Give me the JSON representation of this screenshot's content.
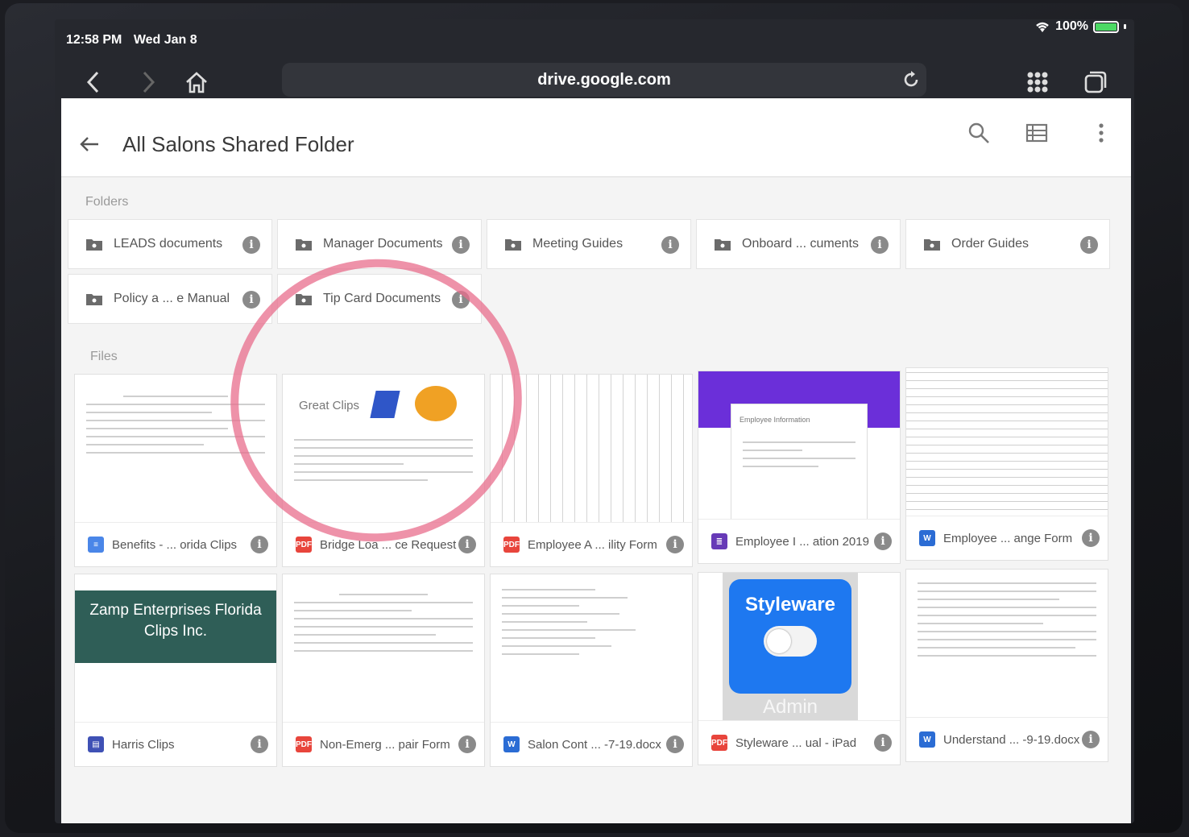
{
  "status_bar": {
    "time": "12:58 PM",
    "date": "Wed Jan 8",
    "battery": "100%"
  },
  "browser": {
    "url": "drive.google.com",
    "icons": [
      "back-icon",
      "forward-icon",
      "home-icon",
      "reload-icon",
      "grid-icon",
      "tabs-icon"
    ]
  },
  "appbar": {
    "title": "All Salons Shared Folder"
  },
  "sections": {
    "folders": "Folders",
    "files": "Files"
  },
  "folders": [
    {
      "label": "LEADS documents"
    },
    {
      "label": "Manager Documents"
    },
    {
      "label": "Meeting Guides"
    },
    {
      "label": "Onboard ... cuments"
    },
    {
      "label": "Order Guides"
    },
    {
      "label": "Policy a ... e Manual"
    },
    {
      "label": "Tip Card Documents"
    }
  ],
  "files": [
    {
      "label": "Benefits - ... orida Clips",
      "type": "doc"
    },
    {
      "label": "Bridge Loa ... ce Request",
      "type": "pdf",
      "thumb_text": "Great Clips"
    },
    {
      "label": "Employee A ... ility Form",
      "type": "pdf"
    },
    {
      "label": "Employee I ... ation 2019",
      "type": "form",
      "thumb_text": "Employee Information"
    },
    {
      "label": "Employee ... ange Form",
      "type": "word"
    },
    {
      "label": "Harris Clips",
      "type": "slides",
      "thumb_text": "Zamp Enterprises Florida Clips Inc."
    },
    {
      "label": "Non-Emerg ... pair Form",
      "type": "pdf"
    },
    {
      "label": "Salon Cont ... -7-19.docx",
      "type": "word"
    },
    {
      "label": "Styleware ... ual - iPad",
      "type": "pdf",
      "thumb_text": "Styleware",
      "thumb_sub": "Admin"
    },
    {
      "label": "Understand ... -9-19.docx",
      "type": "word"
    }
  ],
  "info_glyph": "i",
  "type_badges": {
    "pdf": "PDF",
    "word": "W"
  },
  "colors": {
    "pdf": "#e8453c",
    "doc": "#4a86e8",
    "word": "#2b6cd4",
    "form": "#673ab7",
    "slides": "#3f51b5",
    "annotation": "#e86e8c"
  }
}
